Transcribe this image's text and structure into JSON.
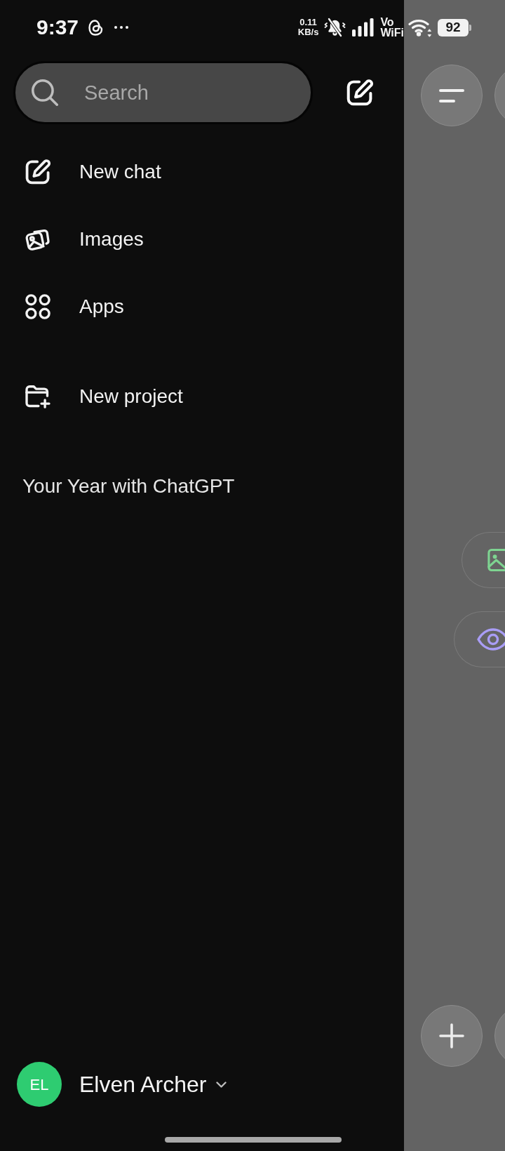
{
  "status_bar": {
    "time": "9:37",
    "speed_value": "0.11",
    "speed_unit": "KB/s",
    "network_top": "Vo",
    "network_bottom": "WiFi",
    "battery": "92"
  },
  "drawer": {
    "search": {
      "placeholder": "Search"
    },
    "menu": [
      {
        "kind": "compose",
        "label": "New chat"
      },
      {
        "kind": "images",
        "label": "Images"
      },
      {
        "kind": "apps",
        "label": "Apps"
      }
    ],
    "projects": [
      {
        "kind": "folder_add",
        "label": "New project"
      }
    ],
    "section_title": "Your Year with ChatGPT",
    "account": {
      "initials": "EL",
      "name": "Elven Archer",
      "color": "#2ecc71"
    }
  },
  "chat_behind": {
    "chips": [
      {
        "kind": "image",
        "color": "#7ed491"
      },
      {
        "kind": "eye",
        "color": "#a99df5"
      }
    ]
  }
}
